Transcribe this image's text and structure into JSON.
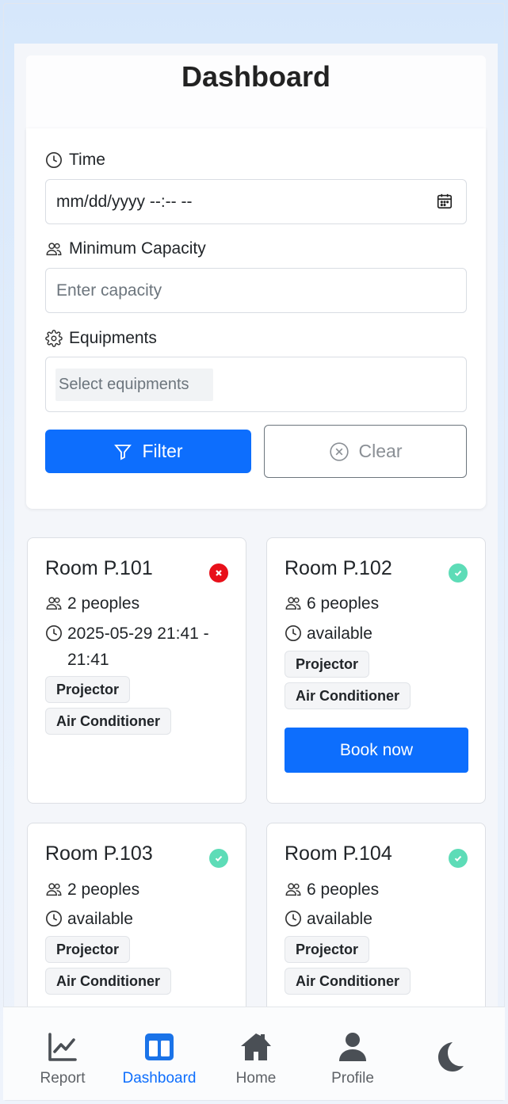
{
  "header": {
    "title": "Dashboard"
  },
  "filters": {
    "time_label": "Time",
    "time_value": "mm/dd/yyyy --:--  --",
    "capacity_label": "Minimum Capacity",
    "capacity_placeholder": "Enter capacity",
    "equipments_label": "Equipments",
    "equipments_placeholder": "Select equipments",
    "filter_button": "Filter",
    "clear_button": "Clear"
  },
  "rooms": [
    {
      "name": "Room P.101",
      "status": "unavailable",
      "capacity": "2 peoples",
      "time_text": "2025-05-29 21:41 - 21:41",
      "equipment": [
        "Projector",
        "Air Conditioner"
      ]
    },
    {
      "name": "Room P.102",
      "status": "available",
      "capacity": "6 peoples",
      "time_text": "available",
      "equipment": [
        "Projector",
        "Air Conditioner"
      ],
      "action": "Book now"
    },
    {
      "name": "Room P.103",
      "status": "available",
      "capacity": "2 peoples",
      "time_text": "available",
      "equipment": [
        "Projector",
        "Air Conditioner"
      ]
    },
    {
      "name": "Room P.104",
      "status": "available",
      "capacity": "6 peoples",
      "time_text": "available",
      "equipment": [
        "Projector",
        "Air Conditioner"
      ]
    }
  ],
  "nav": {
    "items": [
      {
        "label": "Report",
        "icon": "chart-line-icon",
        "active": false
      },
      {
        "label": "Dashboard",
        "icon": "columns-icon",
        "active": true
      },
      {
        "label": "Home",
        "icon": "home-icon",
        "active": false
      },
      {
        "label": "Profile",
        "icon": "user-icon",
        "active": false
      },
      {
        "label": "",
        "icon": "moon-icon",
        "active": false
      }
    ]
  },
  "colors": {
    "primary": "#0d6efd",
    "busy": "#e8101a",
    "free": "#5ddcb7"
  }
}
